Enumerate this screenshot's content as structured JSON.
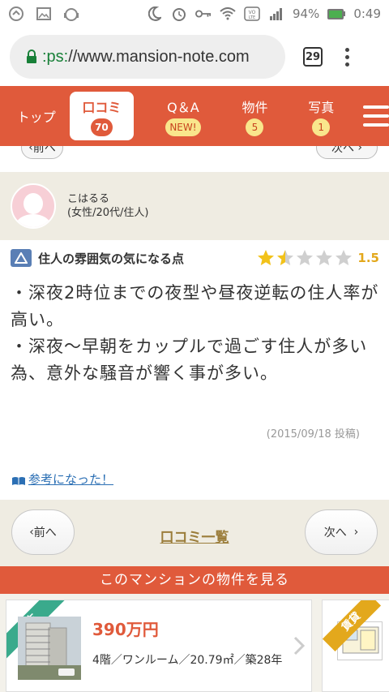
{
  "status": {
    "battery": "94%",
    "time": "0:49"
  },
  "browser": {
    "url_scheme": ":ps:",
    "url_host": "//www.mansion-note.com",
    "tab_count": "29"
  },
  "nav": {
    "top": "トップ",
    "reviews": "口コミ",
    "reviews_count": "70",
    "qa": "Q＆A",
    "qa_badge": "NEW!",
    "bukken": "物件",
    "bukken_count": "5",
    "photo": "写真",
    "photo_count": "1"
  },
  "top_pager": {
    "prev": "前へ",
    "next": "次へ"
  },
  "reviewer": {
    "name": "こはるる",
    "profile": "(女性/20代/住人)"
  },
  "review": {
    "title": "住人の雰囲気の気になる点",
    "score": "1.5",
    "rating_value": 1.5,
    "lines": [
      "・深夜2時位までの夜型や昼夜逆転の住人率が高い。",
      "・深夜～早朝をカップルで過ごす住人が多い為、意外な騒音が響く事が多い。"
    ],
    "date": "(2015/09/18 投稿)",
    "helpful": "参考になった！"
  },
  "pager": {
    "prev": "前へ",
    "list": "口コミ一覧",
    "next": "次へ"
  },
  "see_bukken": "このマンションの物件を見る",
  "cards": [
    {
      "tag": "中古",
      "price": "390万円",
      "spec": "4階／ワンルーム／20.79㎡／築28年"
    },
    {
      "tag": "賃貸"
    }
  ],
  "colors": {
    "brand": "#e05a3b",
    "star": "#f2c21a",
    "link": "#2b6fb4"
  }
}
